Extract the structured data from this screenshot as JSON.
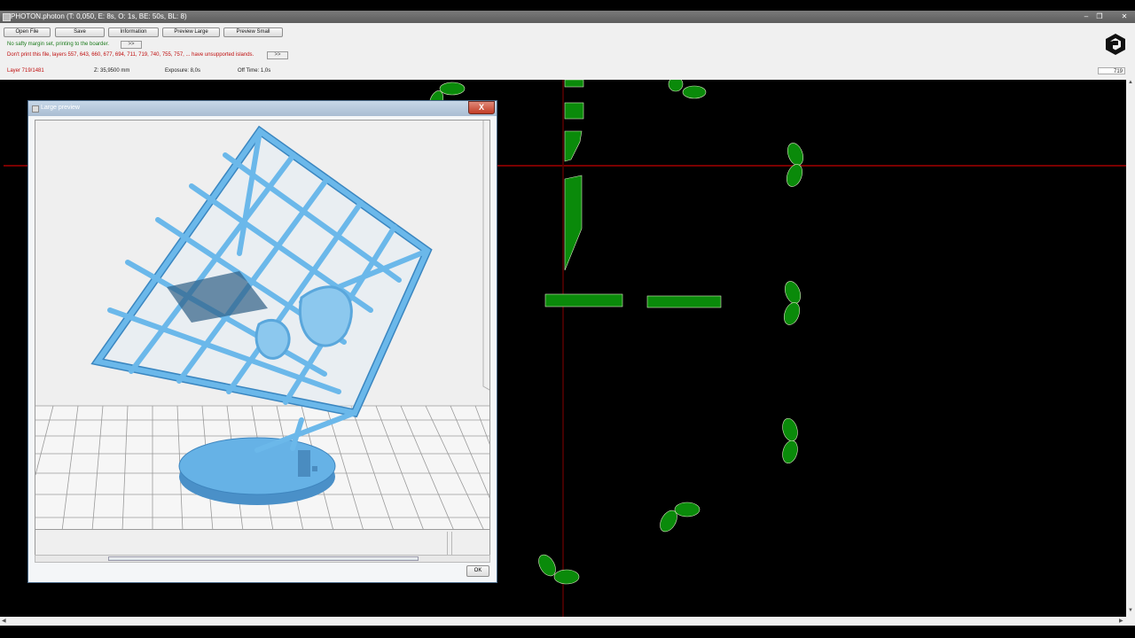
{
  "window": {
    "title": "PHOTON.photon (T: 0,050, E: 8s, O: 1s, BE: 50s, BL: 8)"
  },
  "toolbar": {
    "buttons": [
      "Open File",
      "Save",
      "Information",
      "Preview Large",
      "Preview Small"
    ]
  },
  "messages": {
    "margin": "No safty margin set, printing to the boarder.",
    "margin_button": ">>",
    "islands": "Don't print this file, layers 557, 643, 660, 677, 694, 711, 719, 740, 755, 757, ... have unsupported islands.",
    "islands_button": ">>"
  },
  "status": {
    "layer": "Layer 719/1481",
    "z": "Z: 35,9500 mm",
    "exposure": "Exposure: 8,0s",
    "off_time": "Off Time: 1,0s",
    "layer_input_value": "719"
  },
  "dialog": {
    "title": "Large preview",
    "close": "X",
    "ok": "OK"
  },
  "colors": {
    "layer_green": "#0a8a0a",
    "model_blue": "#58aee0",
    "guide_red": "#7a0000"
  }
}
